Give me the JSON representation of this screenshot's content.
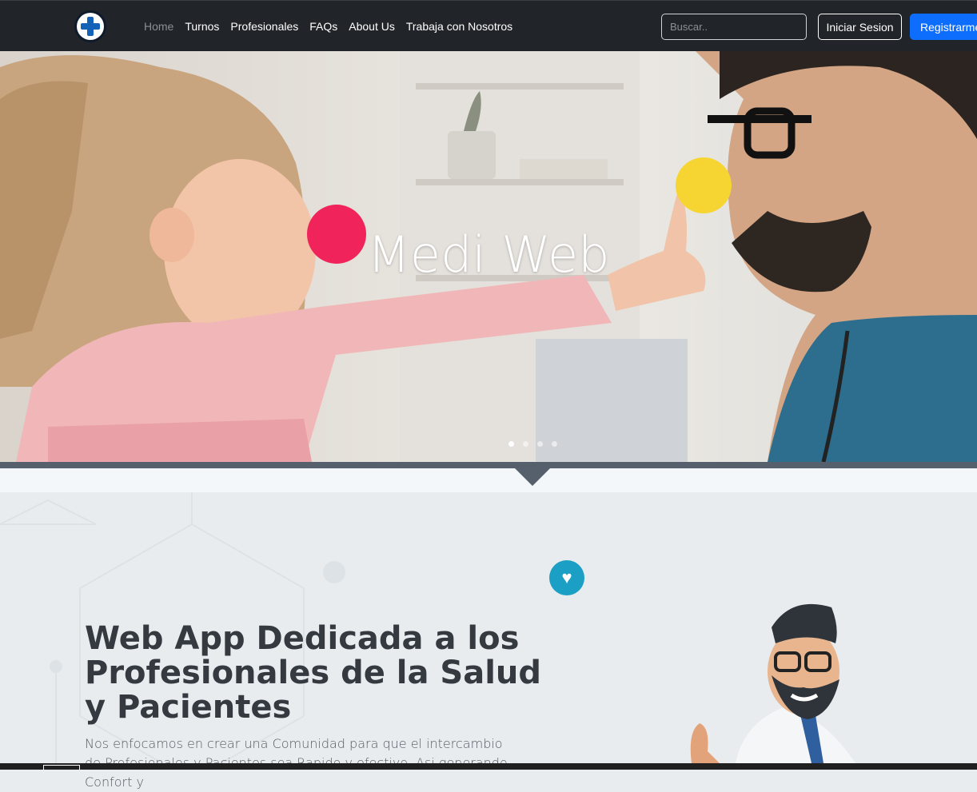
{
  "nav": {
    "links": [
      {
        "label": "Home",
        "active": true
      },
      {
        "label": "Turnos"
      },
      {
        "label": "Profesionales"
      },
      {
        "label": "FAQs"
      },
      {
        "label": "About Us"
      },
      {
        "label": "Trabaja con Nosotros"
      }
    ],
    "search_placeholder": "Buscar..",
    "login_label": "Iniciar Sesion",
    "register_label": "Registrarme"
  },
  "hero": {
    "title": "Medi Web",
    "slide_count": 4,
    "active_slide": 1
  },
  "main": {
    "headline": "Web App Dedicada a los Profesionales de la Salud y Pacientes",
    "paragraph": "Nos enfocamos en crear una Comunidad para que el intercambio de Profesionales y Pacientes sea Rapido y efectivo. Asi generando Confort y"
  },
  "colors": {
    "navbar_bg": "#212529",
    "primary": "#0d6efd",
    "accent_heart": "#1b9fc4",
    "page_bg": "#e9ecef"
  },
  "icons": [
    "medical-cross-logo-icon",
    "heart-icon"
  ]
}
